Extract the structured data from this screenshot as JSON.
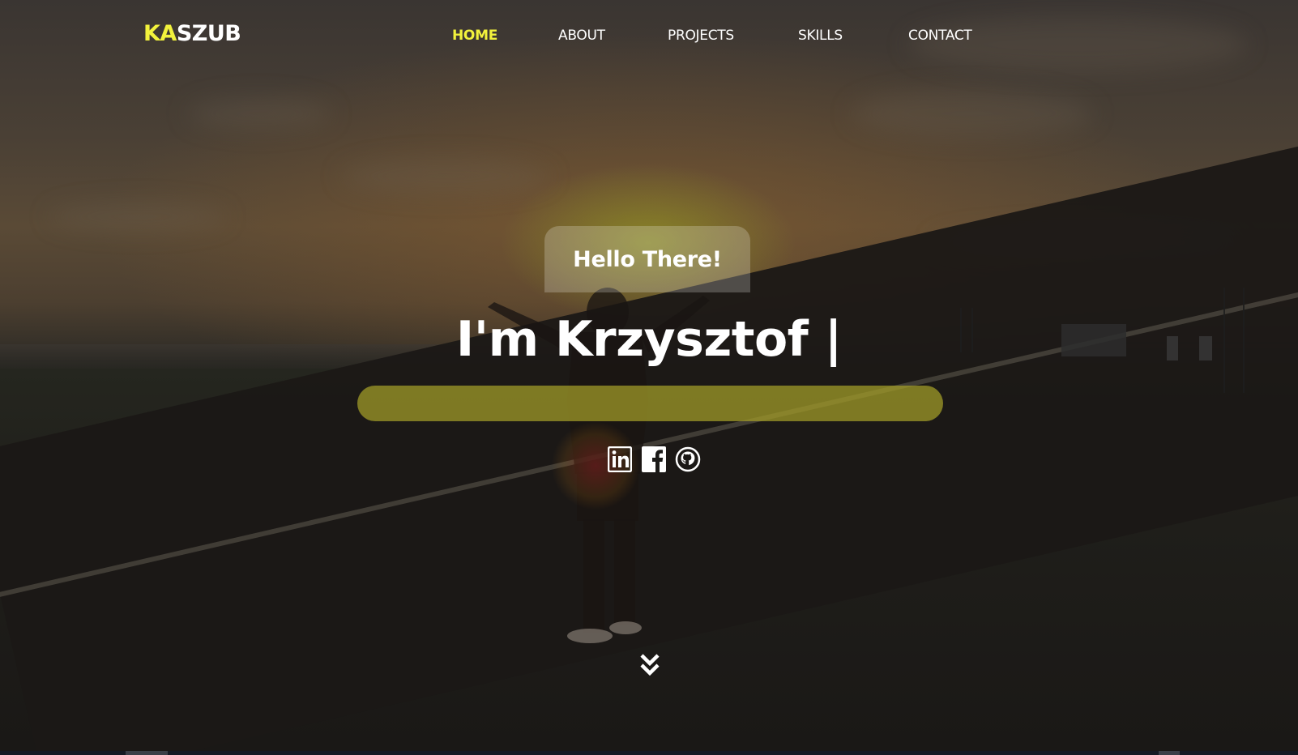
{
  "brand": {
    "logo_accent": "KA",
    "logo_rest": "SZUB",
    "accent_color": "#f2f23c"
  },
  "nav": {
    "items": [
      {
        "label": "HOME",
        "active": true
      },
      {
        "label": "ABOUT",
        "active": false
      },
      {
        "label": "PROJECTS",
        "active": false
      },
      {
        "label": "SKILLS",
        "active": false
      },
      {
        "label": "CONTACT",
        "active": false
      }
    ]
  },
  "hero": {
    "greeting": "Hello There!",
    "headline": "I'm Krzysztof |",
    "subtitle": ""
  },
  "socials": [
    {
      "icon": "linkedin-icon"
    },
    {
      "icon": "facebook-icon"
    },
    {
      "icon": "github-icon"
    }
  ],
  "scroll": {
    "icon": "double-chevron-down-icon"
  }
}
